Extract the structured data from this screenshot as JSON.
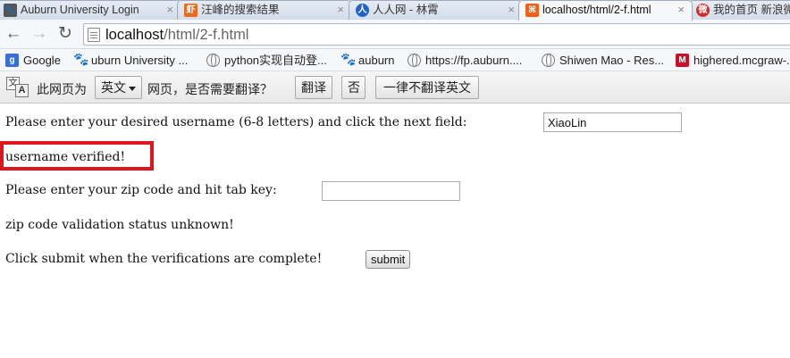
{
  "tabs": [
    {
      "title": "Auburn University Login",
      "icon": "auburn-paw-icon",
      "active": false
    },
    {
      "title": "汪峰的搜索结果",
      "icon": "search-result-icon",
      "active": false
    },
    {
      "title": "人人网 - 林霄",
      "icon": "renren-icon",
      "active": false
    },
    {
      "title": "localhost/html/2-f.html",
      "icon": "xampp-icon",
      "active": true
    },
    {
      "title": "我的首页 新浪微",
      "icon": "weibo-icon",
      "active": false
    }
  ],
  "toolbar": {
    "url_host": "localhost",
    "url_path": "/html/2-f.html"
  },
  "bookmarks": [
    {
      "label": "Google",
      "icon": "google-icon"
    },
    {
      "label": "uburn University ...",
      "icon": "auburn-paw-icon"
    },
    {
      "label": "python实现自动登...",
      "icon": "globe-icon"
    },
    {
      "label": "auburn",
      "icon": "auburn-paw-icon"
    },
    {
      "label": "https://fp.auburn....",
      "icon": "globe-icon"
    },
    {
      "label": "Shiwen Mao - Res...",
      "icon": "globe-icon"
    },
    {
      "label": "highered.mcgraw-...",
      "icon": "mcgraw-icon"
    }
  ],
  "translate_bar": {
    "prefix": "此网页为",
    "language": "英文",
    "question": "网页，是否需要翻译？",
    "translate_label": "翻译",
    "no_label": "否",
    "never_label": "一律不翻译英文"
  },
  "form": {
    "username_prompt": "Please enter your desired username (6-8 letters) and click the next field:",
    "username_value": "XiaoLin",
    "username_status": "username verified!",
    "zip_prompt": "Please enter your zip code and hit tab key:",
    "zip_value": "",
    "zip_status": "zip code validation status unknown!",
    "submit_prompt": "Click submit when the verifications are complete!",
    "submit_label": "submit"
  },
  "colors": {
    "highlight_border": "#e0151d",
    "tab_strip": "#cfd9e7"
  }
}
